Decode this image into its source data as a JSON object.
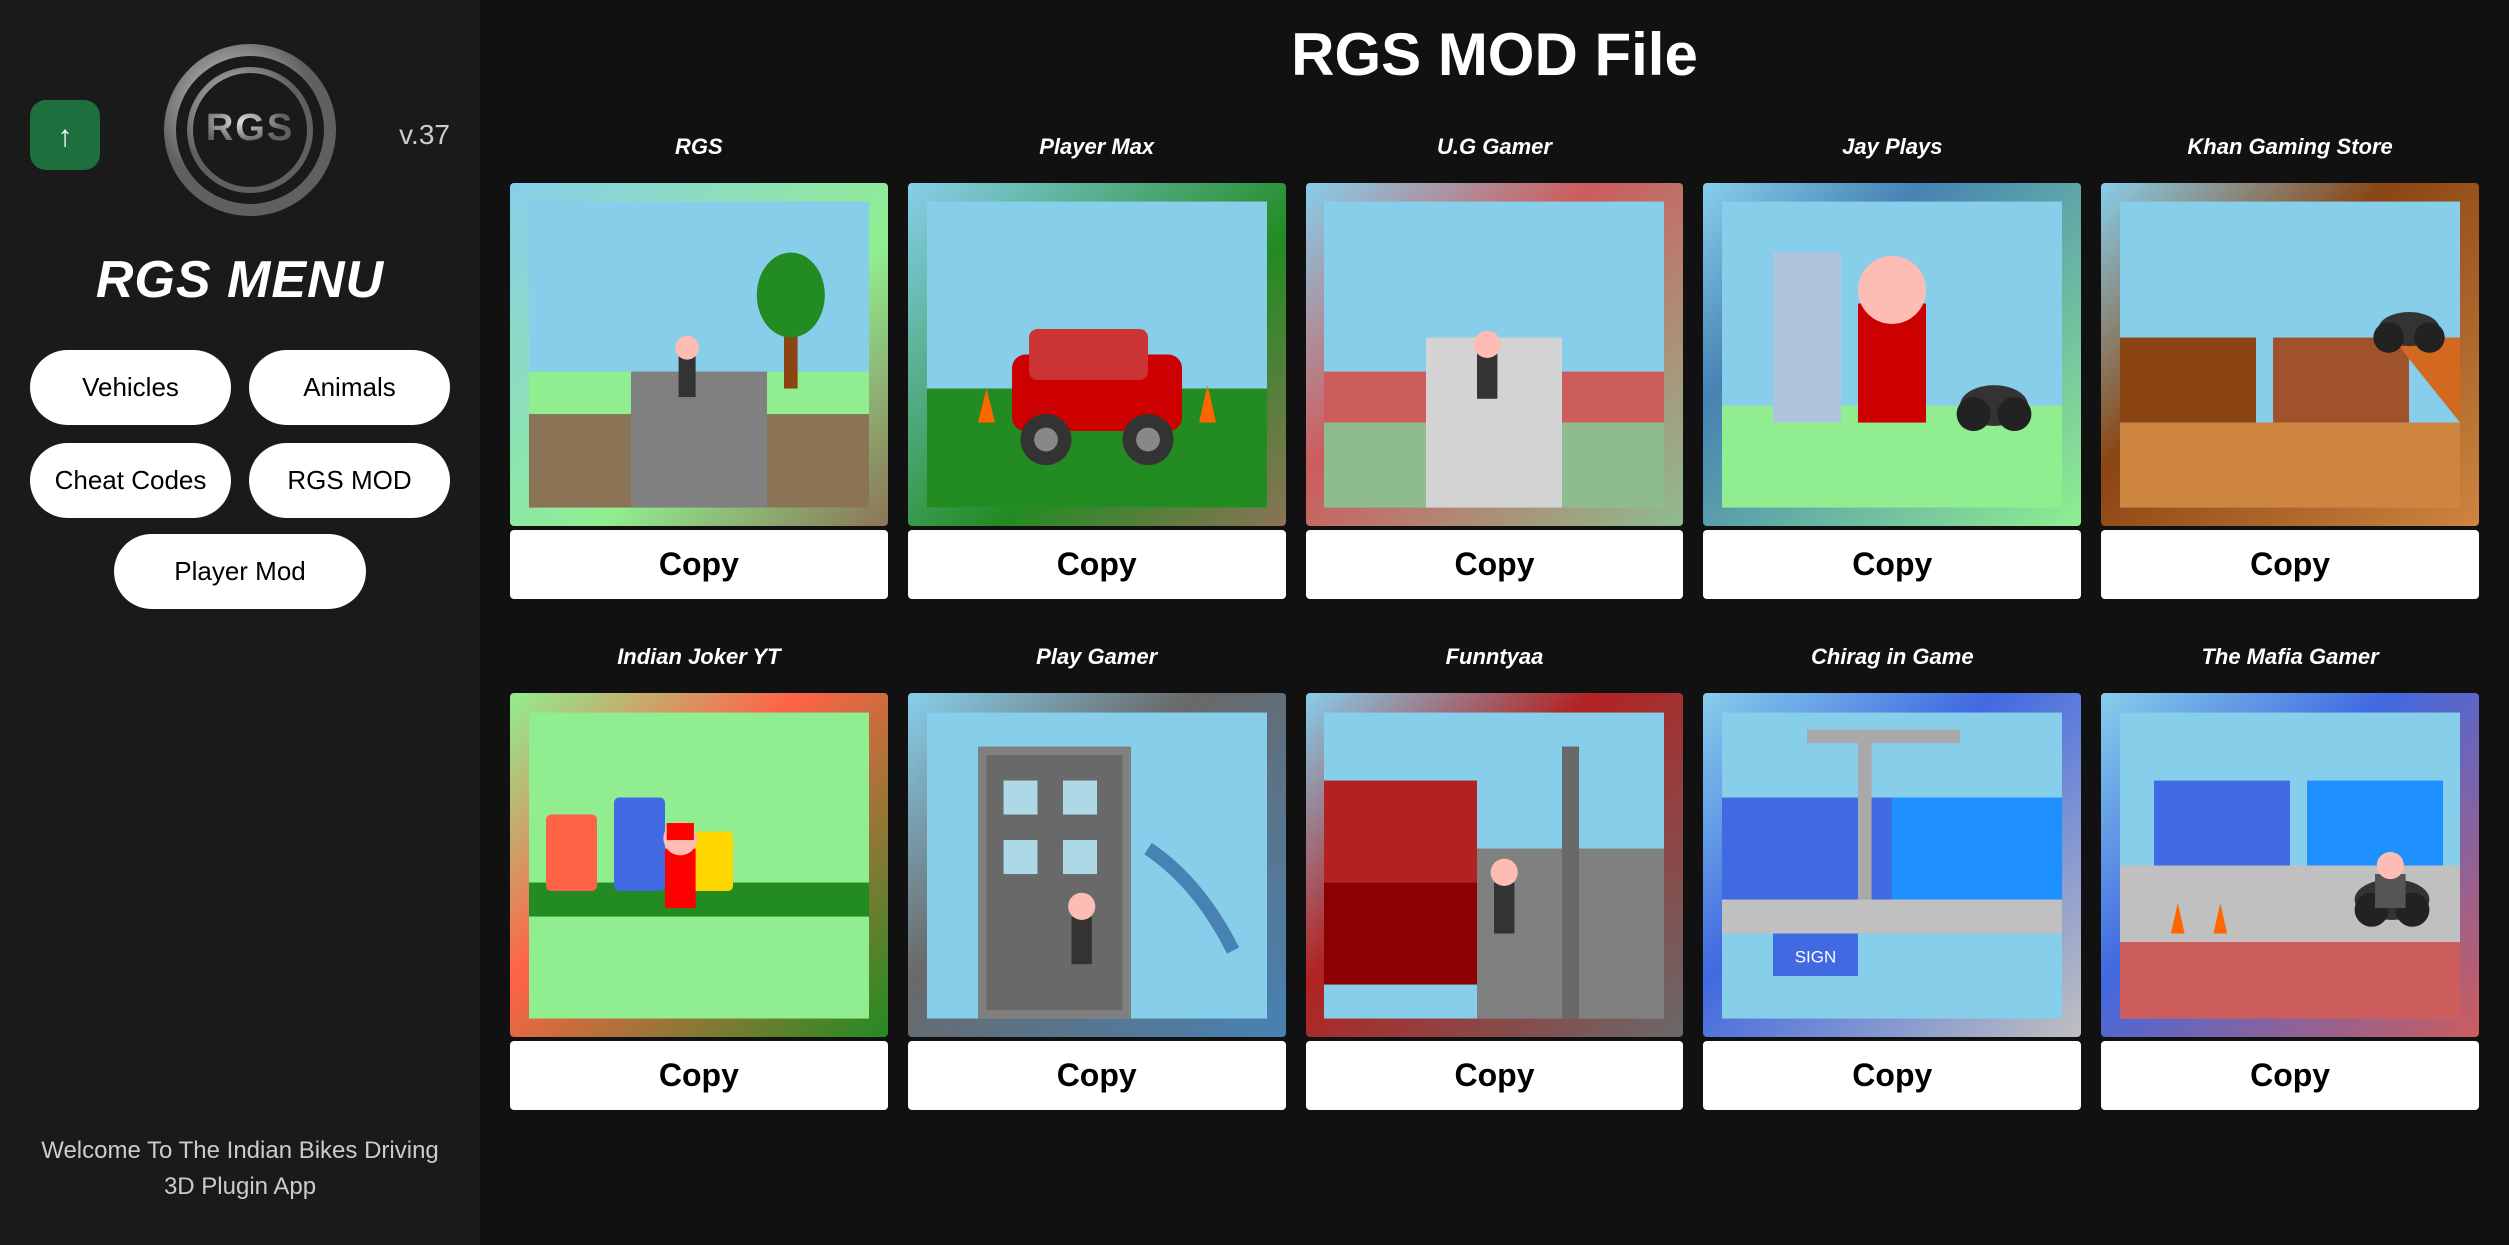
{
  "sidebar": {
    "version": "v.37",
    "title": "RGS MENU",
    "nav_buttons": [
      {
        "id": "vehicles",
        "label": "Vehicles"
      },
      {
        "id": "animals",
        "label": "Animals"
      },
      {
        "id": "cheat-codes",
        "label": "Cheat Codes"
      },
      {
        "id": "rgs-mod",
        "label": "RGS MOD"
      }
    ],
    "player_mod_label": "Player Mod",
    "welcome_text": "Welcome To The Indian Bikes Driving 3D Plugin App"
  },
  "main": {
    "title": "RGS MOD File",
    "copy_label": "Copy",
    "rows": [
      {
        "cards": [
          {
            "id": "rgs",
            "label": "RGS",
            "scene": "scene-rgs"
          },
          {
            "id": "playermax",
            "label": "Player Max",
            "scene": "scene-playermax"
          },
          {
            "id": "ug",
            "label": "U.G Gamer",
            "scene": "scene-ug"
          },
          {
            "id": "jayplays",
            "label": "Jay Plays",
            "scene": "scene-jayplays"
          },
          {
            "id": "khan",
            "label": "Khan Gaming Store",
            "scene": "scene-khan"
          }
        ]
      },
      {
        "cards": [
          {
            "id": "joker",
            "label": "Indian Joker YT",
            "scene": "scene-joker"
          },
          {
            "id": "playgamer",
            "label": "Play Gamer",
            "scene": "scene-playgamer"
          },
          {
            "id": "funntyaa",
            "label": "Funntyaa",
            "scene": "scene-funntyaa"
          },
          {
            "id": "chirag",
            "label": "Chirag in Game",
            "scene": "scene-chirag"
          },
          {
            "id": "mafia",
            "label": "The Mafia Gamer",
            "scene": "scene-mafia"
          }
        ]
      }
    ]
  }
}
